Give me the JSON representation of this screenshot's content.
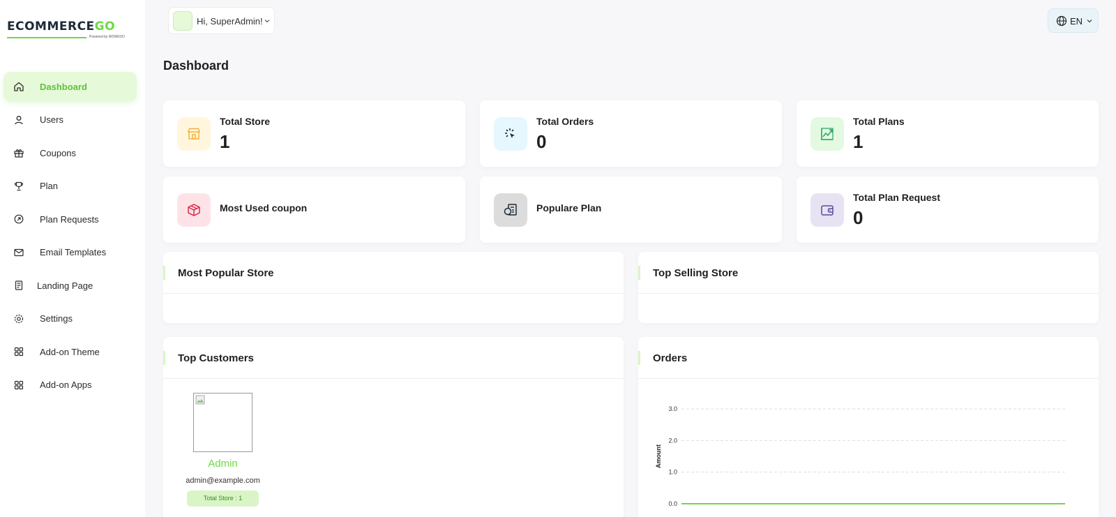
{
  "brand": {
    "logo_main": "ECOMMERCE",
    "logo_accent": "GO",
    "logo_sub": "Powered by WORKDO"
  },
  "sidebar": {
    "items": [
      {
        "label": "Dashboard",
        "icon": "home-icon",
        "active": true
      },
      {
        "label": "Users",
        "icon": "user-icon"
      },
      {
        "label": "Coupons",
        "icon": "gift-icon"
      },
      {
        "label": "Plan",
        "icon": "trophy-icon"
      },
      {
        "label": "Plan Requests",
        "icon": "arrow-circle-icon"
      },
      {
        "label": "Email Templates",
        "icon": "mail-icon"
      },
      {
        "label": "Landing Page",
        "icon": "document-icon"
      },
      {
        "label": "Settings",
        "icon": "gear-icon"
      },
      {
        "label": "Add-on Theme",
        "icon": "grid-icon"
      },
      {
        "label": "Add-on Apps",
        "icon": "grid-icon"
      }
    ]
  },
  "header": {
    "greeting": "Hi, SuperAdmin!",
    "language": "EN"
  },
  "page": {
    "title": "Dashboard"
  },
  "stats": [
    {
      "label": "Total Store",
      "value": "1",
      "icon": "store-icon",
      "color": "#f5b03a",
      "bg": "#fff6dd"
    },
    {
      "label": "Total Orders",
      "value": "0",
      "icon": "cursor-click-icon",
      "color": "#1c2b39",
      "bg": "#e6f7fd"
    },
    {
      "label": "Total Plans",
      "value": "1",
      "icon": "chart-icon",
      "color": "#29a361",
      "bg": "#e3f9e2"
    },
    {
      "label": "Most Used coupon",
      "value": "",
      "icon": "package-icon",
      "color": "#e0284c",
      "bg": "#fde3e7"
    },
    {
      "label": "Populare Plan",
      "value": "",
      "icon": "plan-doc-icon",
      "color": "#1c2b39",
      "bg": "#dcdcdc"
    },
    {
      "label": "Total Plan Request",
      "value": "0",
      "icon": "wallet-icon",
      "color": "#5b4a9e",
      "bg": "#e8e3f3"
    }
  ],
  "panels": {
    "popular_store": "Most Popular Store",
    "top_selling": "Top Selling Store",
    "top_customers": "Top Customers",
    "orders": "Orders"
  },
  "customer": {
    "name": "Admin",
    "email": "admin@example.com",
    "badge": "Total Store : 1"
  },
  "colors": {
    "accent": "#6fd943",
    "accent_light": "#e6f9d9"
  },
  "chart_data": {
    "type": "line",
    "title": "Orders",
    "ylabel": "Amount",
    "xlabel": "",
    "ylim": [
      0,
      3
    ],
    "yticks": [
      "0.0",
      "1.0",
      "2.0",
      "3.0"
    ],
    "categories": [
      "",
      "",
      "",
      "",
      "",
      "",
      ""
    ],
    "series": [
      {
        "values": [
          0,
          0,
          0,
          0,
          0,
          0,
          0
        ],
        "color": "#6fd943"
      }
    ],
    "grid": true
  }
}
